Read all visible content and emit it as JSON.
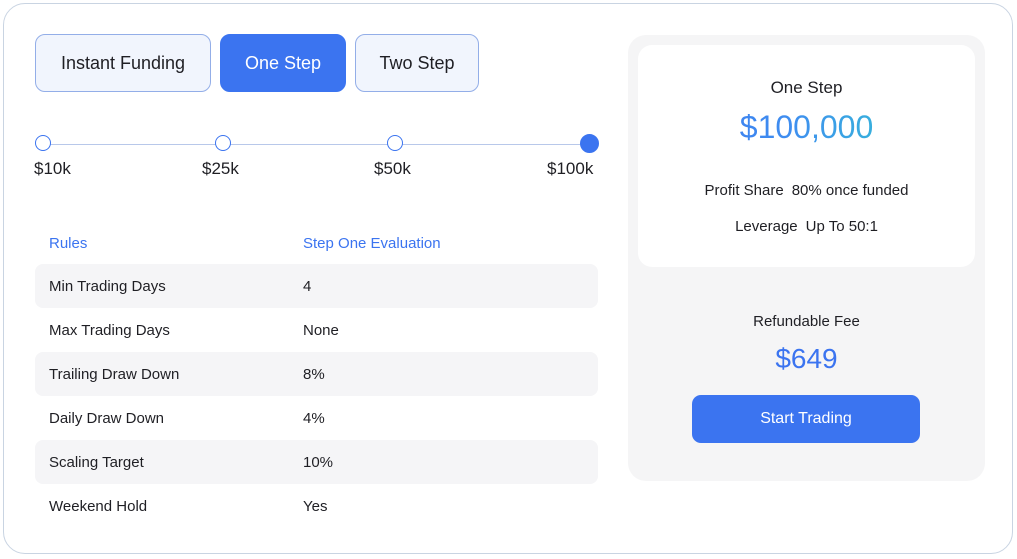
{
  "tabs": [
    {
      "label": "Instant Funding",
      "active": false
    },
    {
      "label": "One Step",
      "active": true
    },
    {
      "label": "Two Step",
      "active": false
    }
  ],
  "slider": {
    "options": [
      "$10k",
      "$25k",
      "$50k",
      "$100k"
    ],
    "selected_index": 3
  },
  "table": {
    "headers": [
      "Rules",
      "Step One Evaluation"
    ],
    "rows": [
      [
        "Min Trading Days",
        "4"
      ],
      [
        "Max Trading Days",
        "None"
      ],
      [
        "Trailing Draw Down",
        "8%"
      ],
      [
        "Daily Draw Down",
        "4%"
      ],
      [
        "Scaling Target",
        "10%"
      ],
      [
        "Weekend Hold",
        "Yes"
      ]
    ]
  },
  "summary": {
    "plan_name": "One Step",
    "amount": "$100,000",
    "profit_share_label": "Profit Share",
    "profit_share_value": "80% once funded",
    "leverage_label": "Leverage",
    "leverage_value": "Up To 50:1",
    "fee_label": "Refundable Fee",
    "fee_value": "$649",
    "cta_label": "Start Trading"
  },
  "colors": {
    "accent": "#3b74f0",
    "gradient_end": "#2fd6c7",
    "panel_bg": "#f5f5f6",
    "row_shade": "#f5f5f7"
  }
}
